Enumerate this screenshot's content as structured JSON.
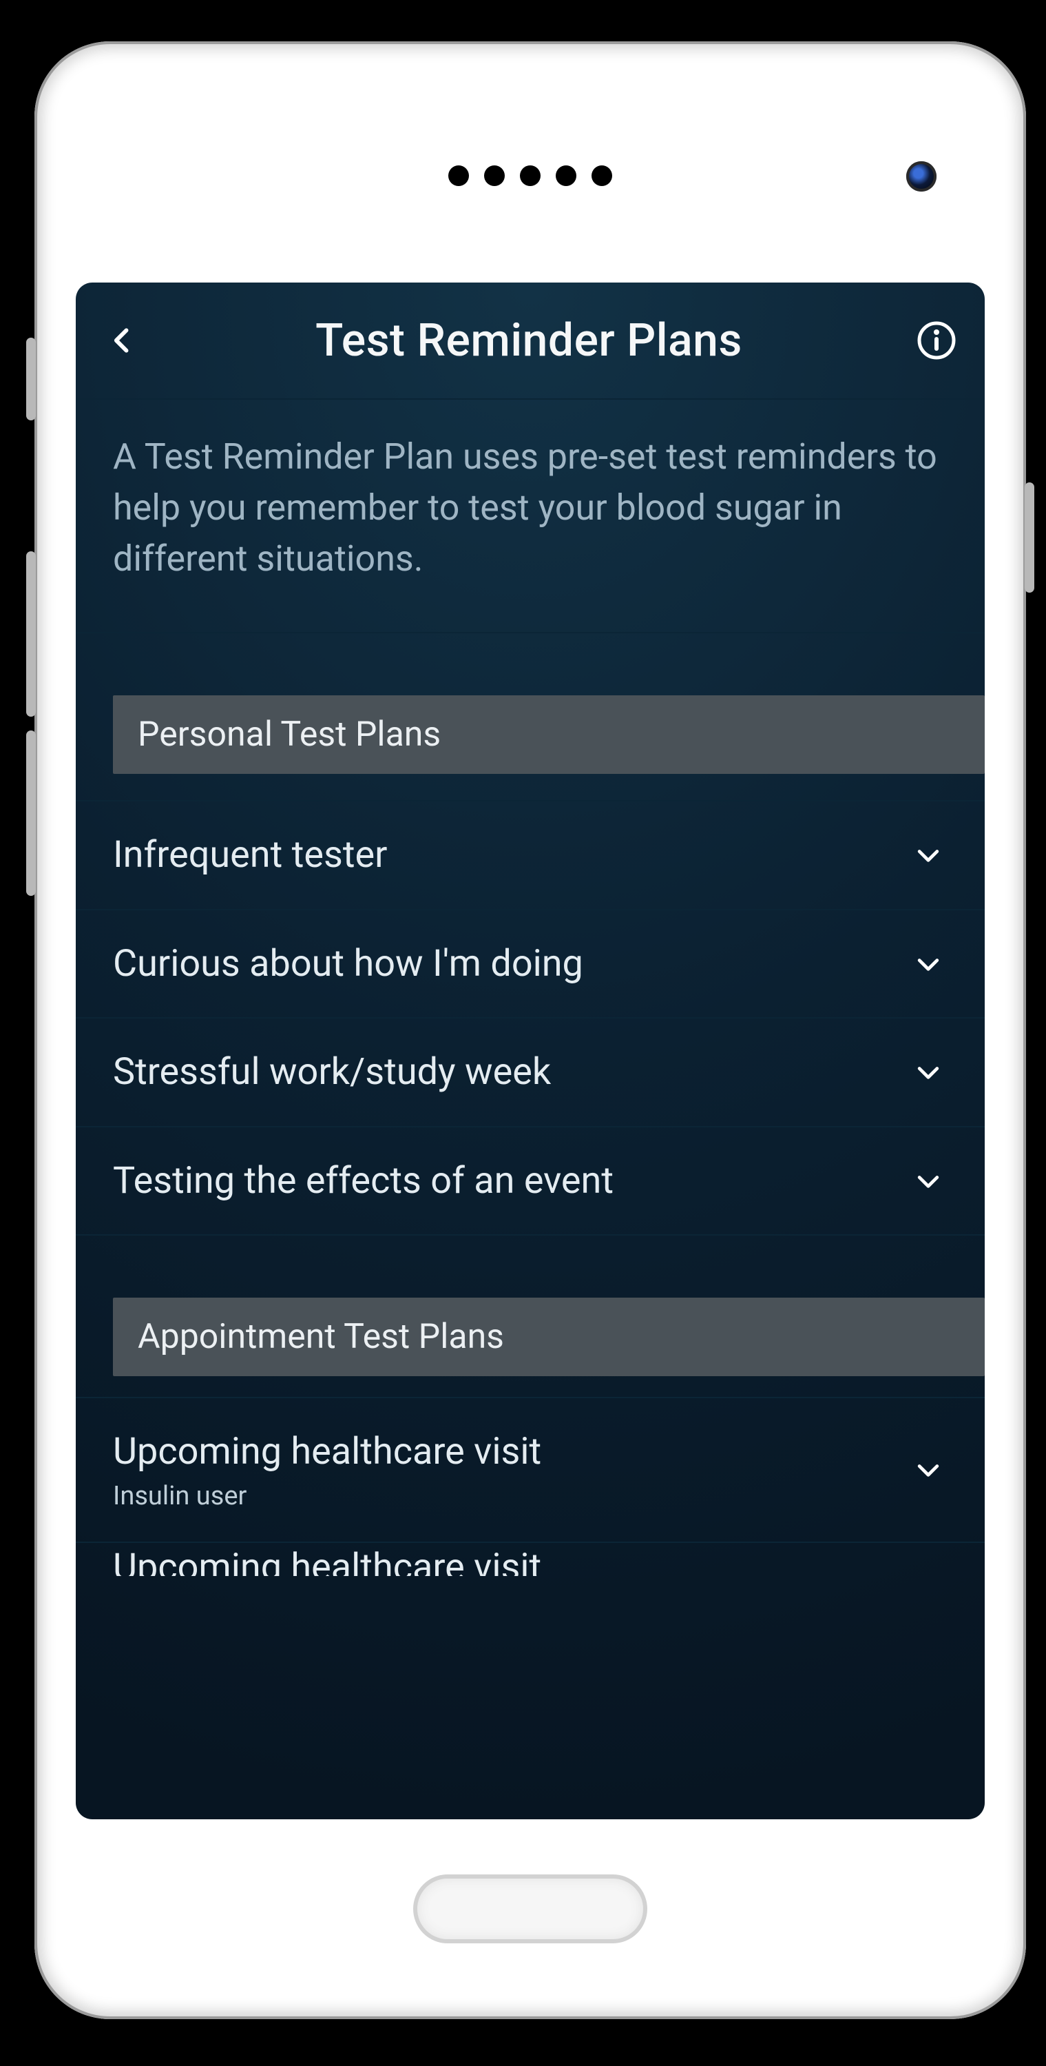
{
  "header": {
    "title": "Test Reminder Plans"
  },
  "intro": "A Test Reminder Plan uses pre-set test reminders to help you remember to test your blood sugar in different situations.",
  "sections": {
    "personal": {
      "heading": "Personal Test Plans",
      "items": [
        {
          "label": "Infrequent tester"
        },
        {
          "label": "Curious about how I'm doing"
        },
        {
          "label": "Stressful work/study week"
        },
        {
          "label": "Testing the effects of an event"
        }
      ]
    },
    "appointment": {
      "heading": "Appointment Test Plans",
      "items": [
        {
          "label": "Upcoming healthcare visit",
          "sub": "Insulin user"
        },
        {
          "label": "Upcoming healthcare visit"
        }
      ]
    }
  },
  "icons": {
    "back": "chevron-left",
    "info": "info-circle",
    "expand": "chevron-down"
  },
  "colors": {
    "bg_top": "#123246",
    "bg_bottom": "#071522",
    "text_primary": "#e6eef3",
    "text_secondary": "#9fb5c4",
    "pill_bg": "#4a5258",
    "divider": "#0b2536"
  }
}
